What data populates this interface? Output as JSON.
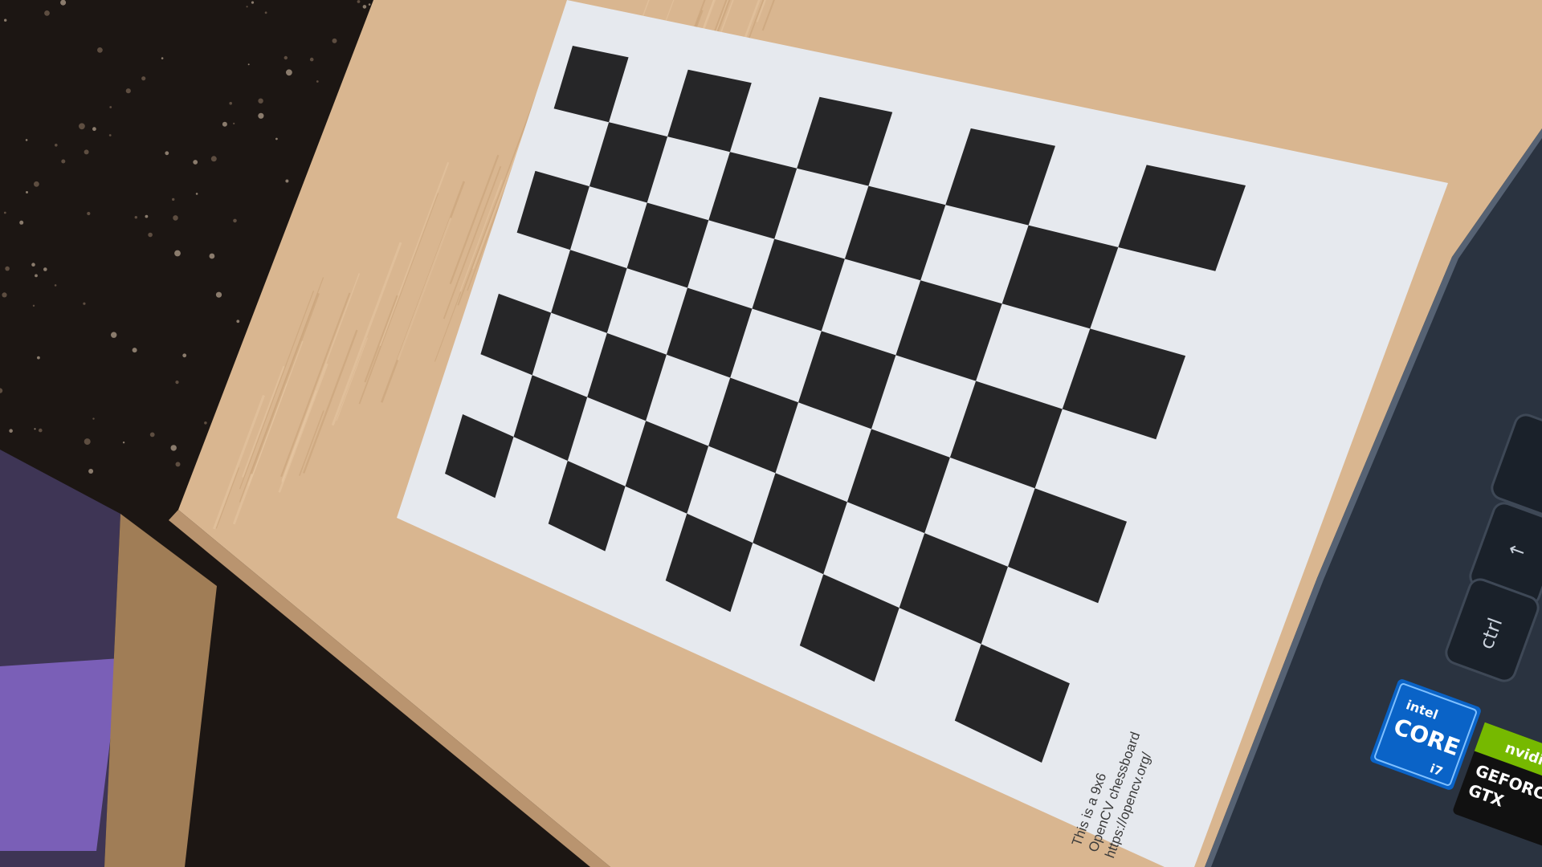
{
  "scene": {
    "colors": {
      "floor": "#1c1613",
      "table": "#d9b690",
      "table_edge": "#b9946f",
      "paper": "#e6e9ee",
      "checker": "#262628",
      "laptop": "#2a3340",
      "key": "#1a212a",
      "intel_blue": "#0a63c7",
      "nvidia_green": "#76b900"
    }
  },
  "paper": {
    "caption_lines": [
      "This is a 9x6",
      "OpenCV chessboard",
      "https://opencv.org/"
    ]
  },
  "laptop": {
    "key_ctrl": "ctrl",
    "key_up": "↑",
    "intel_sticker": {
      "brand": "intel",
      "product": "CORE",
      "tier": "i7"
    },
    "nvidia_sticker": {
      "brand": "nvidia",
      "line1": "GEFORCE",
      "line2": "GTX"
    }
  }
}
